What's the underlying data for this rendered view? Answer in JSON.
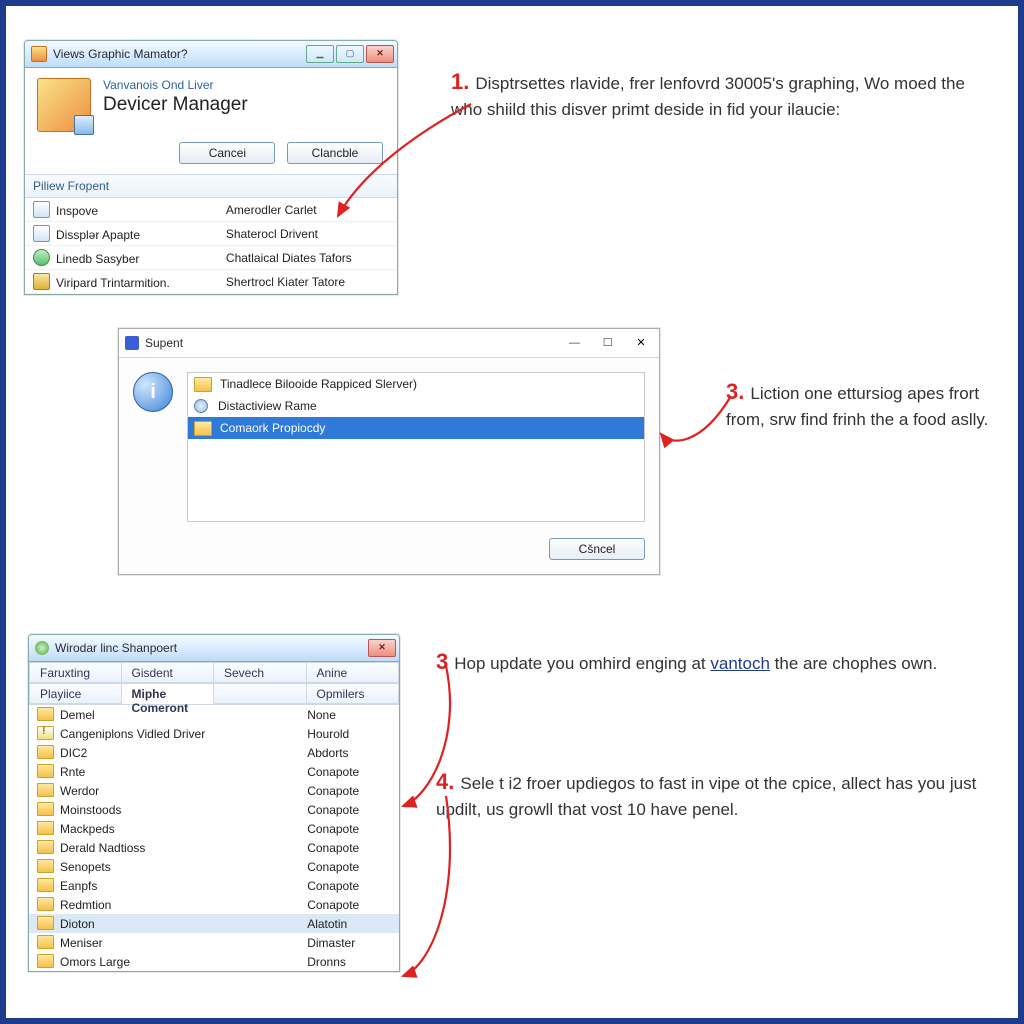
{
  "w1": {
    "title": "Views Graphic Mamator?",
    "subtitle": "Vanvanois Ond Liver",
    "heading": "Devicer Manager",
    "cancel": "Cancei",
    "clancble": "Clancble",
    "tab": "Piliew Fropent",
    "rows": [
      {
        "a": "Inspove",
        "b": "Amerodler Carlet"
      },
      {
        "a": "Dissplər Apapte",
        "b": "Shaterocl Drivent"
      },
      {
        "a": "Linedb Sasyber",
        "b": "Chatlaical Diates Tafors"
      },
      {
        "a": "Viripard Trintarmition.",
        "b": "Shertrocl Kiater Tatore"
      }
    ]
  },
  "w2": {
    "title": "Supent",
    "items": [
      "Tinadlece Bilooide Rappiced Slerver)",
      "Distactiview Rame",
      "Comaork Propiocdy"
    ],
    "cancel": "Cšncel"
  },
  "w3": {
    "title": "Wirodar linc Shanpoert",
    "tabs": [
      "Faruxting",
      "Gisdent",
      "Sevech",
      "Anine",
      "Playiice",
      "Miphe Comeront",
      "",
      "Opmilers"
    ],
    "activeTab": 5,
    "rows": [
      {
        "a": "Demel",
        "b": "None",
        "w": false
      },
      {
        "a": "Cangeniplons Vidled Driver",
        "b": "Hourold",
        "w": true
      },
      {
        "a": "DIC2",
        "b": "Abdorts",
        "w": false
      },
      {
        "a": "Rnte",
        "b": "Conapote",
        "w": false
      },
      {
        "a": "Werdor",
        "b": "Conapote",
        "w": false
      },
      {
        "a": "Moinstoods",
        "b": "Conapote",
        "w": false
      },
      {
        "a": "Mackpeds",
        "b": "Conapote",
        "w": false
      },
      {
        "a": "Derald Nadtioss",
        "b": "Conapote",
        "w": false
      },
      {
        "a": "Senopets",
        "b": "Conapote",
        "w": false
      },
      {
        "a": "Eanpfs",
        "b": "Conapote",
        "w": false
      },
      {
        "a": "Redmtion",
        "b": "Conapote",
        "w": false
      },
      {
        "a": "Dioton",
        "b": "Alatotin",
        "w": false,
        "hi": true
      },
      {
        "a": "Meniser",
        "b": "Dimaster",
        "w": false
      },
      {
        "a": "Omors Large",
        "b": "Dronns",
        "w": false
      }
    ]
  },
  "steps": {
    "s1n": "1.",
    "s1": "Disptrsettes rlavide, frer lenfovrd 30005's graphing, Wo moed the who shiild this disver primt deside in fid your ilaucie:",
    "s2n": "3.",
    "s2": "Liction one ettursiog apes frort from, srw find frinh the a food aslly.",
    "s3n": "3",
    "s3a": "Hop update you omhird enging at ",
    "s3l": "vantoch",
    "s3b": " the are chophes own.",
    "s4n": "4.",
    "s4": "Sele t i2 froer updiegos to fast in vipe ot the cpice, allect has you just updilt, us growll that vost 10 have penel."
  }
}
